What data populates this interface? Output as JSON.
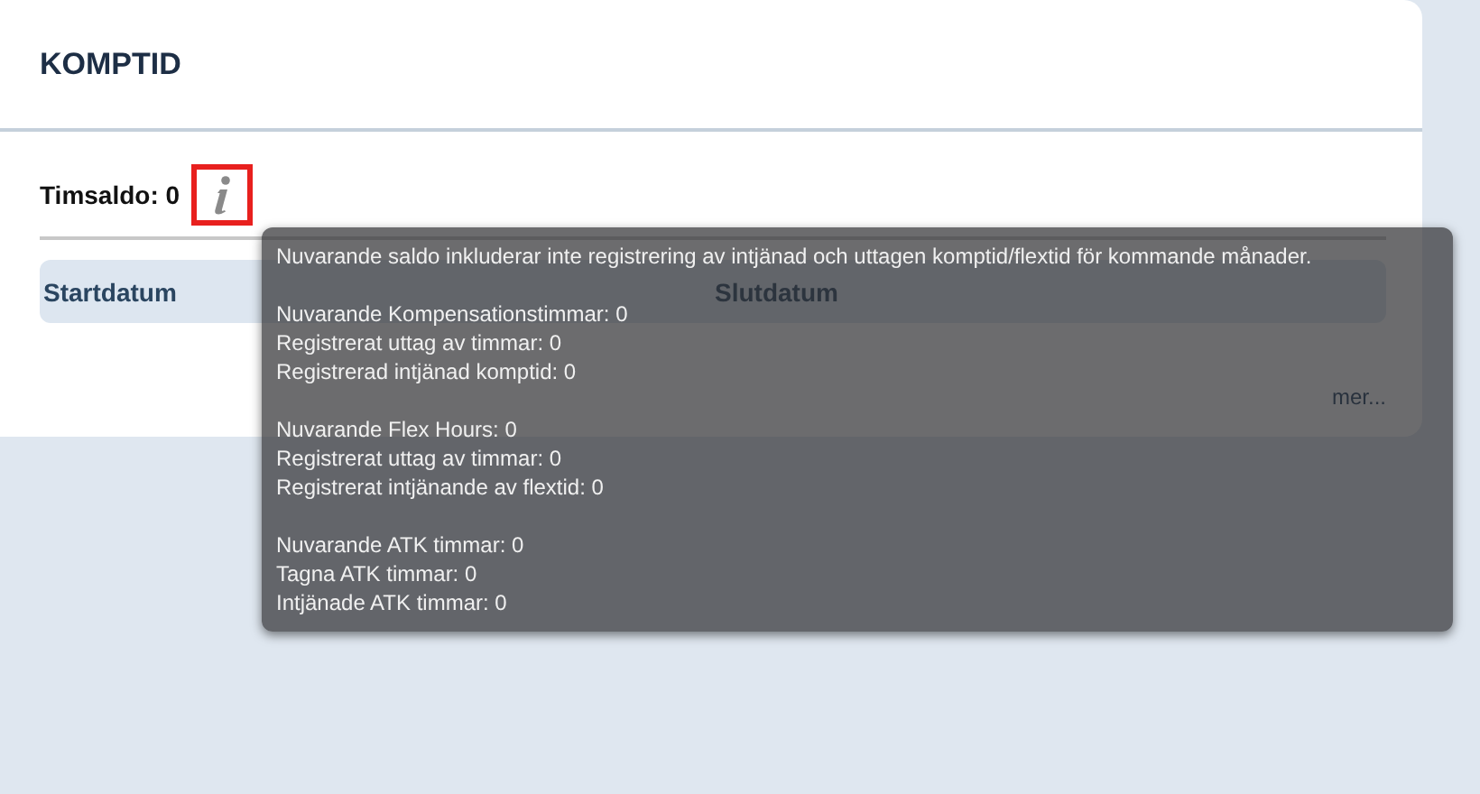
{
  "card": {
    "title": "KOMPTID",
    "balance_label": "Timsaldo: 0",
    "table": {
      "columns": [
        "Startdatum",
        "Slutdatum"
      ]
    },
    "more_link": "mer..."
  },
  "tooltip": {
    "intro": "Nuvarande saldo inkluderar inte registrering av intjänad och uttagen komptid/flextid för kommande månader.",
    "groups": [
      [
        "Nuvarande Kompensationstimmar: 0",
        "Registrerat uttag av timmar: 0",
        "Registrerad intjänad komptid: 0"
      ],
      [
        "Nuvarande Flex Hours: 0",
        "Registrerat uttag av timmar: 0",
        "Registrerat intjänande av flextid: 0"
      ],
      [
        "Nuvarande ATK timmar: 0",
        "Tagna ATK timmar: 0",
        "Intjänade ATK timmar: 0"
      ]
    ]
  }
}
